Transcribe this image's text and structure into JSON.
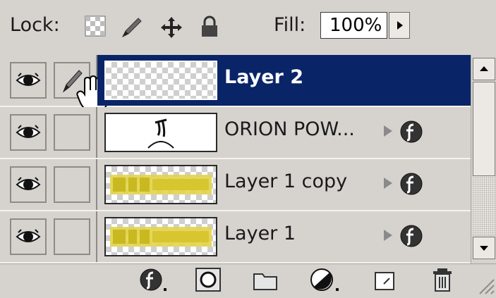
{
  "lock": {
    "label": "Lock:",
    "icons": [
      "lock-transparent-icon",
      "lock-image-icon",
      "lock-position-icon",
      "lock-all-icon"
    ]
  },
  "fill": {
    "label": "Fill:",
    "value": "100%"
  },
  "layers": [
    {
      "name": "Layer 2",
      "selected": true,
      "thumbnail": "transparent",
      "link": "brush-icon",
      "has_effects": false
    },
    {
      "name": "ORION POW...",
      "selected": false,
      "thumbnail": "text-art",
      "has_effects": true
    },
    {
      "name": "Layer 1 copy",
      "selected": false,
      "thumbnail": "yellow-text",
      "has_effects": true
    },
    {
      "name": "Layer 1",
      "selected": false,
      "thumbnail": "yellow-text",
      "has_effects": true
    }
  ],
  "bottom_icons": [
    "layer-style-icon",
    "layer-mask-icon",
    "new-group-icon",
    "adjustment-layer-icon",
    "new-layer-icon",
    "trash-icon"
  ],
  "colors": {
    "selected_row": "#0a2468",
    "panel_bg": "#d6d3ce"
  }
}
